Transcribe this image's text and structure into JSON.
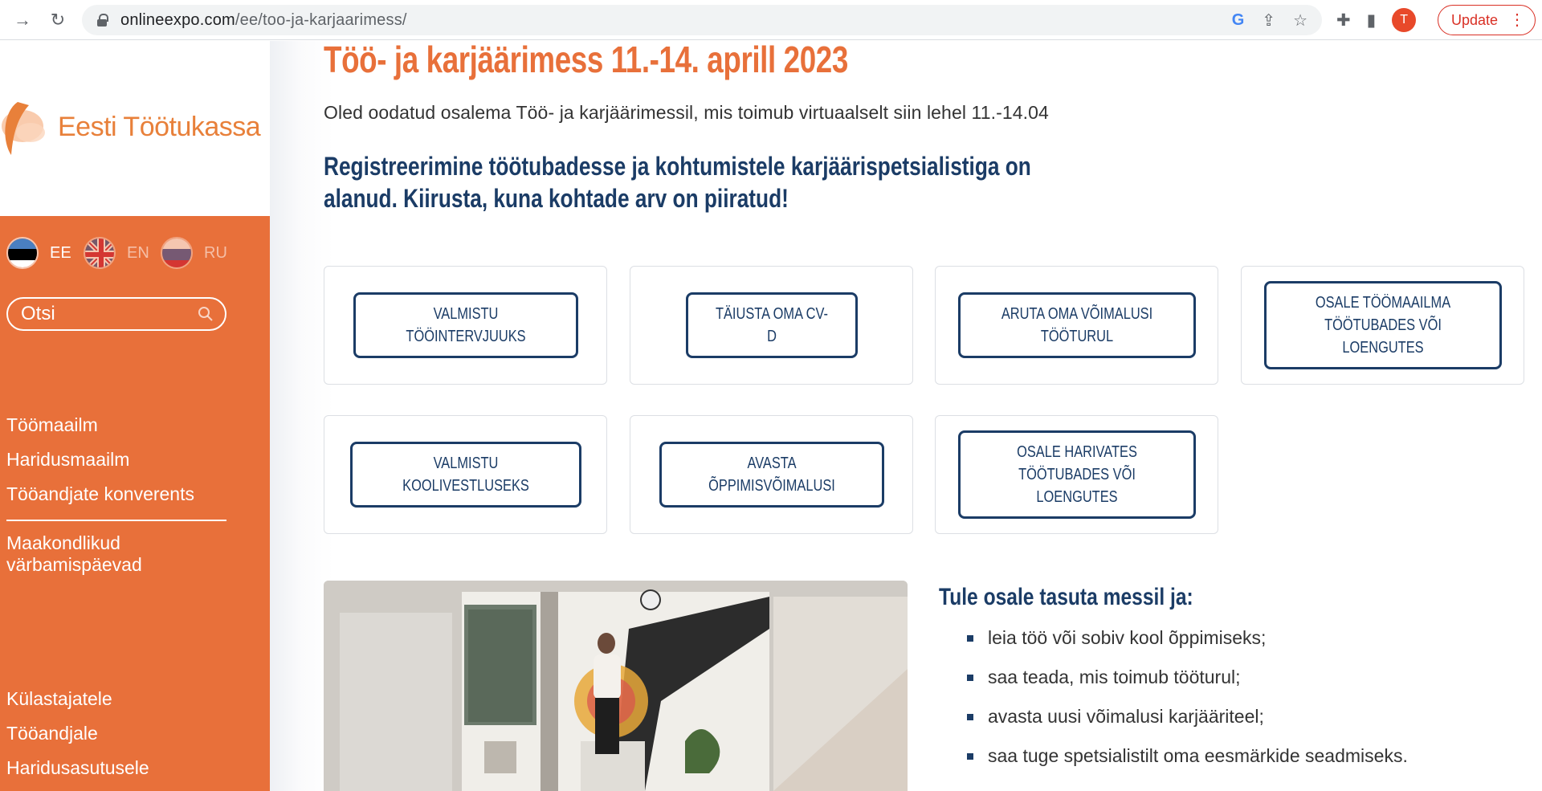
{
  "browser": {
    "url_host": "onlineexpo.com",
    "url_path": "/ee/too-ja-karjaarimess/",
    "avatar_letter": "T",
    "update_label": "Update"
  },
  "brand": {
    "logo_text": "Eesti Töötukassa",
    "orange": "#e8703a",
    "navy": "#1b3c66"
  },
  "languages": [
    {
      "code": "EE",
      "active": true
    },
    {
      "code": "EN",
      "active": false
    },
    {
      "code": "RU",
      "active": false
    }
  ],
  "search": {
    "placeholder": "Otsi"
  },
  "nav": {
    "primary": [
      "Töömaailm",
      "Haridusmaailm",
      "Tööandjate konverents"
    ],
    "secondary": [
      "Maakondlikud värbamispäevad"
    ],
    "audience": [
      "Külastajatele",
      "Tööandjale",
      "Haridusasutusele"
    ]
  },
  "page": {
    "title": "Töö- ja karjäärimess 11.-14. aprill 2023",
    "intro": "Oled oodatud osalema Töö- ja karjäärimessil, mis toimub virtuaalselt siin lehel 11.-14.04",
    "registration_note": "Registreerimine töötubadesse ja kohtumistele karjäärispetsialistiga on alanud. Kiirusta, kuna kohtade arv on piiratud!"
  },
  "cards": [
    {
      "label": "VALMISTU TÖÖINTERVJUUKS"
    },
    {
      "label": "TÄIUSTA OMA CV-D"
    },
    {
      "label": "ARUTA OMA VÕIMALUSI TÖÖTURUL"
    },
    {
      "label": "OSALE TÖÖMAAILMA TÖÖTUBADES VÕI LOENGUTES"
    },
    {
      "label": "VALMISTU KOOLIVESTLUSEKS"
    },
    {
      "label": "AVASTA ÕPPIMISVÕIMALUSI"
    },
    {
      "label": "OSALE HARIVATES TÖÖTUBADES VÕI LOENGUTES"
    }
  ],
  "benefits": {
    "title": "Tule osale tasuta messil ja:",
    "items": [
      "leia töö või sobiv kool õppimiseks;",
      "saa teada, mis toimub tööturul;",
      "avasta uusi võimalusi karjääriteel;",
      "saa tuge spetsialistilt oma eesmärkide seadmiseks."
    ]
  }
}
